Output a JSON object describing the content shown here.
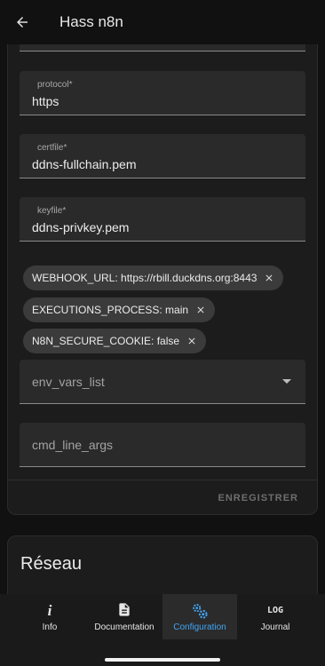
{
  "header": {
    "title": "Hass n8n",
    "back_icon": "arrow-left-icon"
  },
  "fields": {
    "protocol": {
      "label": "protocol*",
      "value": "https"
    },
    "certfile": {
      "label": "certfile*",
      "value": "ddns-fullchain.pem"
    },
    "keyfile": {
      "label": "keyfile*",
      "value": "ddns-privkey.pem"
    }
  },
  "env_chips": [
    "WEBHOOK_URL: https://rbill.duckdns.org:8443",
    "EXECUTIONS_PROCESS: main",
    "N8N_SECURE_COOKIE: false"
  ],
  "env_vars_list": {
    "placeholder": "env_vars_list"
  },
  "cmd_line_args": {
    "placeholder": "cmd_line_args"
  },
  "save_label": "ENREGISTRER",
  "network": {
    "title": "Réseau"
  },
  "nav": [
    {
      "label": "Info",
      "icon": "info-icon",
      "active": false
    },
    {
      "label": "Documentation",
      "icon": "document-icon",
      "active": false
    },
    {
      "label": "Configuration",
      "icon": "gears-icon",
      "active": true
    },
    {
      "label": "Journal",
      "icon": "log-icon",
      "active": false
    }
  ],
  "colors": {
    "accent": "#42a5f5",
    "background": "#111111",
    "card": "#1c1c1c"
  }
}
